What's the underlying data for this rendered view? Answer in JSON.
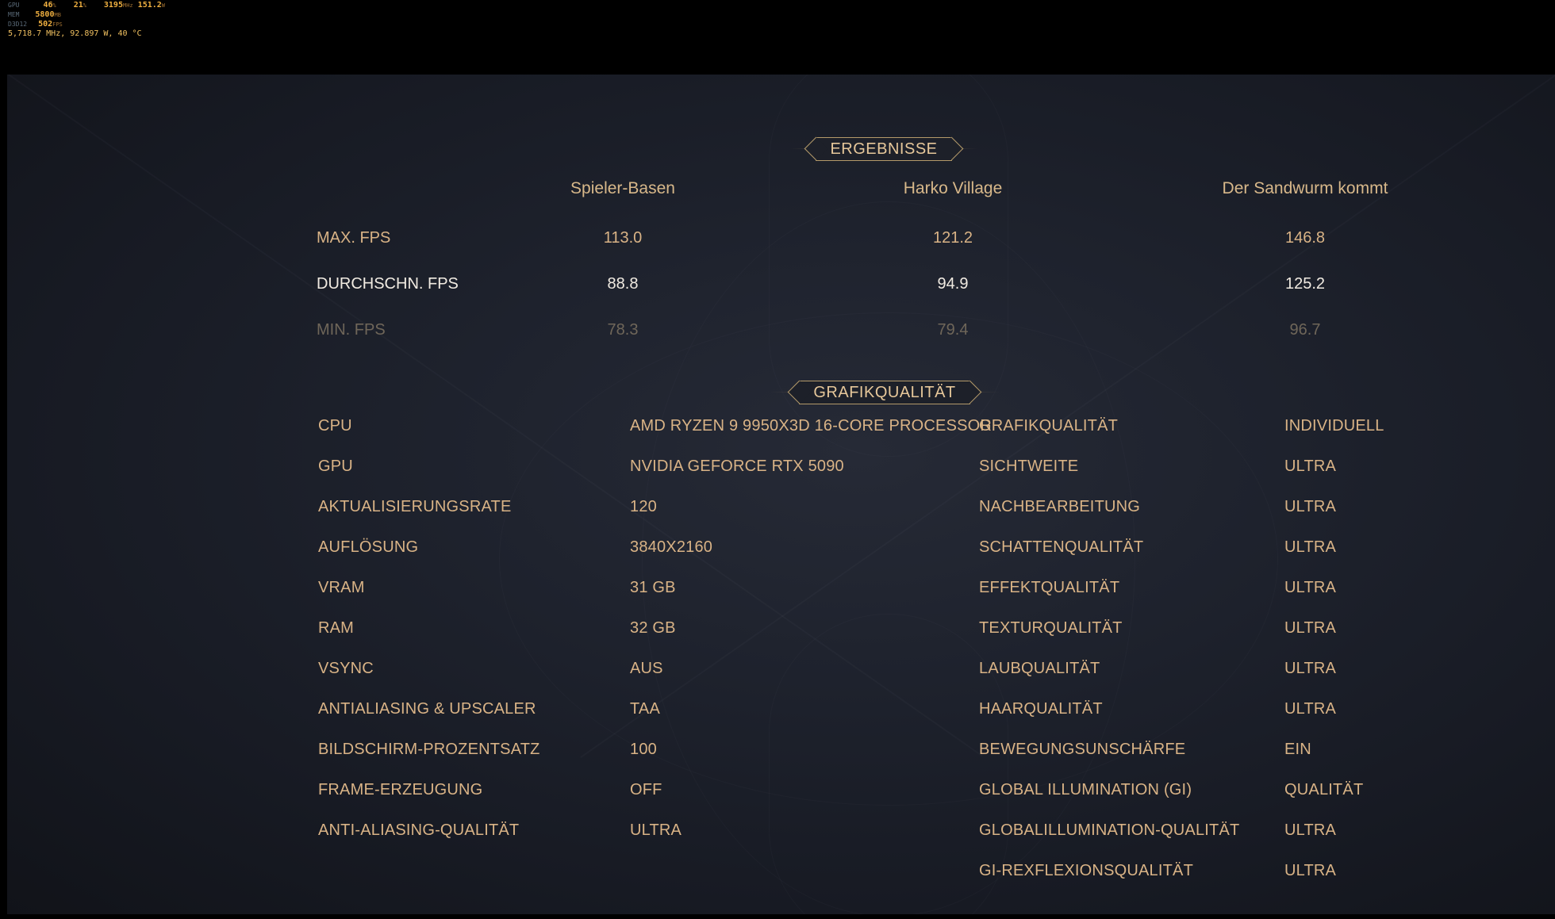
{
  "overlay": {
    "line1": {
      "label": "GPU",
      "v1": "46",
      "u1": "%",
      "v2": "21",
      "u2": "%",
      "v3": "3195",
      "u3": "MHz",
      "v4": "151.2",
      "u4": "W"
    },
    "line2": {
      "label": "MEM",
      "v1": "5800",
      "u1": "MB"
    },
    "line3": {
      "label": "D3D12",
      "v1": "502",
      "u1": "FPS"
    },
    "line4": {
      "text": "5,718.7 MHz, 92.897 W, 40 °C"
    }
  },
  "results": {
    "heading": "ERGEBNISSE",
    "columns": [
      "Spieler-Basen",
      "Harko Village",
      "Der Sandwurm kommt"
    ],
    "rows": [
      {
        "label": "MAX. FPS",
        "values": [
          "113.0",
          "121.2",
          "146.8"
        ]
      },
      {
        "label": "DURCHSCHN. FPS",
        "values": [
          "88.8",
          "94.9",
          "125.2"
        ]
      },
      {
        "label": "MIN. FPS",
        "values": [
          "78.3",
          "79.4",
          "96.7"
        ]
      }
    ]
  },
  "graphics": {
    "heading": "GRAFIKQUALITÄT",
    "left": [
      {
        "label": "CPU",
        "value": "AMD RYZEN 9 9950X3D 16-CORE PROCESSOR"
      },
      {
        "label": "GPU",
        "value": "NVIDIA GEFORCE RTX 5090"
      },
      {
        "label": "AKTUALISIERUNGSRATE",
        "value": "120"
      },
      {
        "label": "AUFLÖSUNG",
        "value": "3840X2160"
      },
      {
        "label": "VRAM",
        "value": "31 GB"
      },
      {
        "label": "RAM",
        "value": "32 GB"
      },
      {
        "label": "VSYNC",
        "value": "AUS"
      },
      {
        "label": "ANTIALIASING & UPSCALER",
        "value": "TAA"
      },
      {
        "label": "BILDSCHIRM-PROZENTSATZ",
        "value": "100"
      },
      {
        "label": "FRAME-ERZEUGUNG",
        "value": "OFF"
      },
      {
        "label": "ANTI-ALIASING-QUALITÄT",
        "value": "ULTRA"
      }
    ],
    "right": [
      {
        "label": "GRAFIKQUALITÄT",
        "value": "INDIVIDUELL"
      },
      {
        "label": "SICHTWEITE",
        "value": "ULTRA"
      },
      {
        "label": "NACHBEARBEITUNG",
        "value": "ULTRA"
      },
      {
        "label": "SCHATTENQUALITÄT",
        "value": "ULTRA"
      },
      {
        "label": "EFFEKTQUALITÄT",
        "value": "ULTRA"
      },
      {
        "label": "TEXTURQUALITÄT",
        "value": "ULTRA"
      },
      {
        "label": "LAUBQUALITÄT",
        "value": "ULTRA"
      },
      {
        "label": "HAARQUALITÄT",
        "value": "ULTRA"
      },
      {
        "label": "BEWEGUNGSUNSCHÄRFE",
        "value": "EIN"
      },
      {
        "label": "GLOBAL ILLUMINATION (GI)",
        "value": "QUALITÄT"
      },
      {
        "label": "GLOBALILLUMINATION-QUALITÄT",
        "value": "ULTRA"
      },
      {
        "label": "GI-REXFLEXIONSQUALITÄT",
        "value": "ULTRA"
      }
    ]
  }
}
